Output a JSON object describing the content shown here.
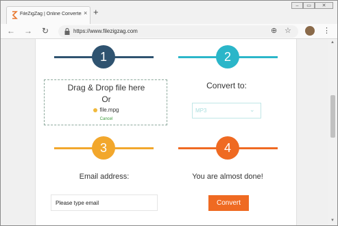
{
  "browser": {
    "tab_title": "FileZigZag | Online Converter",
    "tab_close": "×",
    "new_tab": "+",
    "url": "https://www.filezigzag.com",
    "window_controls": {
      "minimize": "–",
      "maximize": "▭",
      "close": "✕"
    },
    "nav": {
      "back": "←",
      "forward": "→",
      "reload": "↻",
      "zoom": "⊕",
      "bookmark": "☆",
      "menu": "⋮"
    }
  },
  "colors": {
    "step1": "#2f5370",
    "step2": "#2bb6c9",
    "step3": "#f2a72c",
    "step4": "#ef6a22"
  },
  "steps": [
    {
      "number": "1"
    },
    {
      "number": "2"
    },
    {
      "number": "3"
    },
    {
      "number": "4"
    }
  ],
  "upload": {
    "title": "Drag & Drop file here",
    "or": "Or",
    "file_name": "file.mpg",
    "cancel": "Cancel"
  },
  "convert": {
    "label": "Convert to:",
    "format": "MP3",
    "chevron": "⌄"
  },
  "email": {
    "label": "Email address:",
    "placeholder": "Please type email",
    "value": ""
  },
  "finish": {
    "label": "You are almost done!",
    "button": "Convert"
  },
  "scrollbar": {
    "up": "▲",
    "down": "▼"
  }
}
